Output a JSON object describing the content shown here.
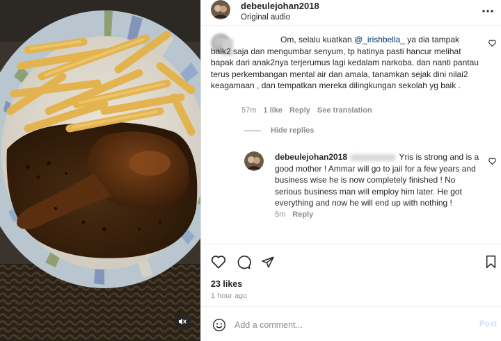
{
  "post": {
    "username": "debeulejohan2018",
    "audio": "Original audio",
    "more_icon": "more-horizontal-icon"
  },
  "comments": [
    {
      "text_before": "Om, selalu kuatkan ",
      "mention": "@_irishbella_",
      "text_after": " ya dia tampak baik2 saja dan mengumbar senyum, tp hatinya pasti hancur melihat bapak dari anak2nya terjerumus lagi kedalam narkoba. dan nanti pantau terus perkembangan mental air dan amala, tanamkan sejak dini nilai2 keagamaan , dan tempatkan mereka dilingkungan sekolah yg baik .",
      "time": "57m",
      "likes": "1 like",
      "reply": "Reply",
      "translate": "See translation"
    }
  ],
  "hide_replies": "Hide replies",
  "reply": {
    "username": "debeulejohan2018",
    "text": "Yris is strong and is a good mother ! Ammar will go to jail for a few years and business wise he is now completely finished ! No serious business man will employ him later. He got everything and now he will end up with nothing !",
    "time": "5m",
    "reply_label": "Reply"
  },
  "actions": {
    "like_icon": "heart-icon",
    "comment_icon": "comment-icon",
    "share_icon": "share-icon",
    "save_icon": "bookmark-icon"
  },
  "likes_count": "23 likes",
  "time_ago": "1 hour ago",
  "comment_box": {
    "placeholder": "Add a comment...",
    "post_label": "Post"
  },
  "media": {
    "mute_icon": "speaker-muted-icon"
  }
}
